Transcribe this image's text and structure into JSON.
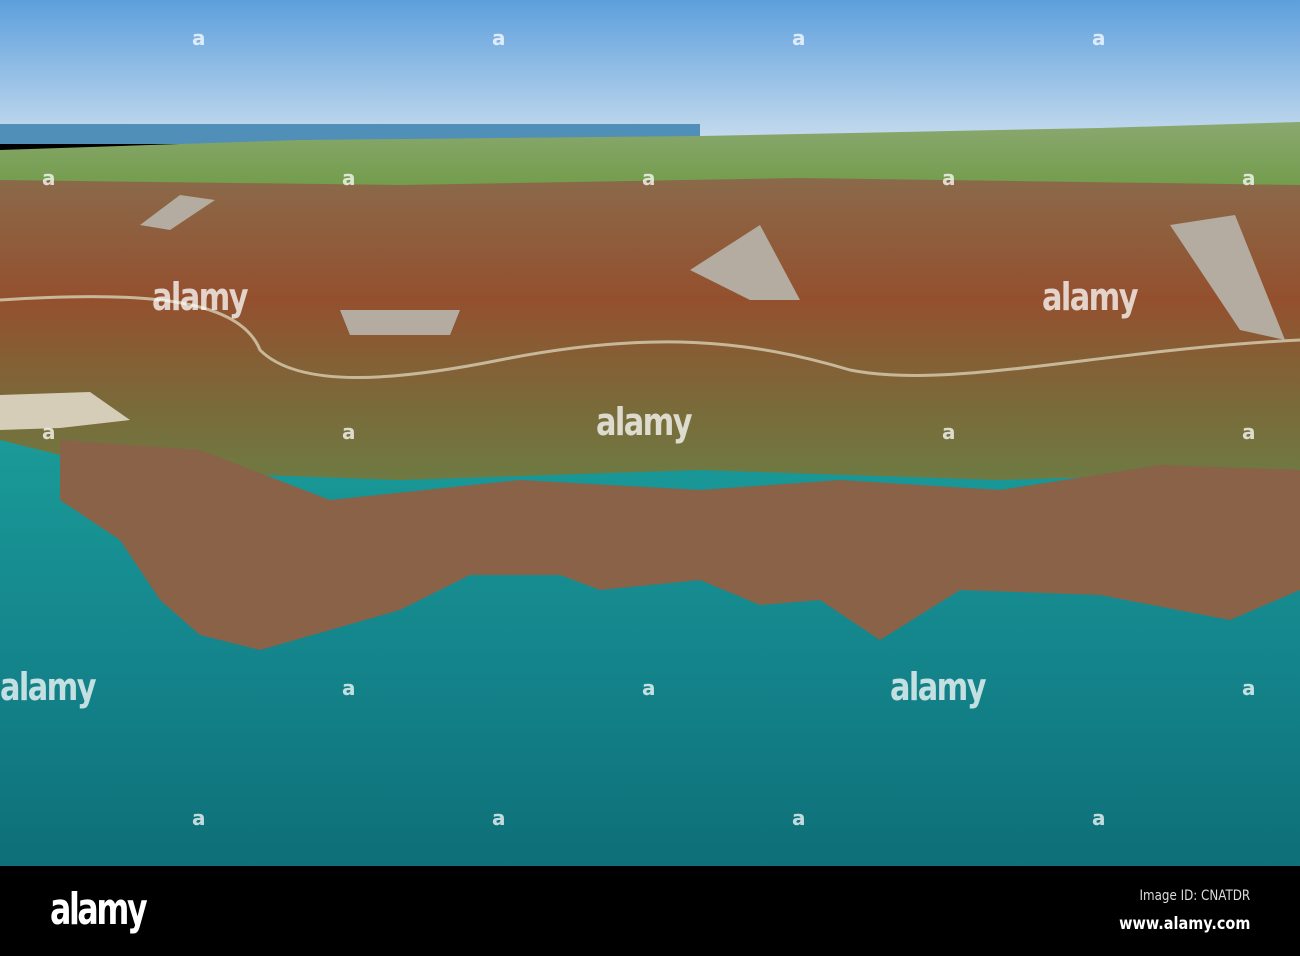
{
  "watermark": {
    "text": "alamy",
    "mark": "a"
  },
  "footer": {
    "logo": "alamy",
    "image_id": "Image ID: CNATDR",
    "url": "www.alamy.com"
  },
  "colors": {
    "sky": "#6aa8e0",
    "sea": "#12808a",
    "heath": "#8a5a3a",
    "fields": "#7aa050"
  }
}
